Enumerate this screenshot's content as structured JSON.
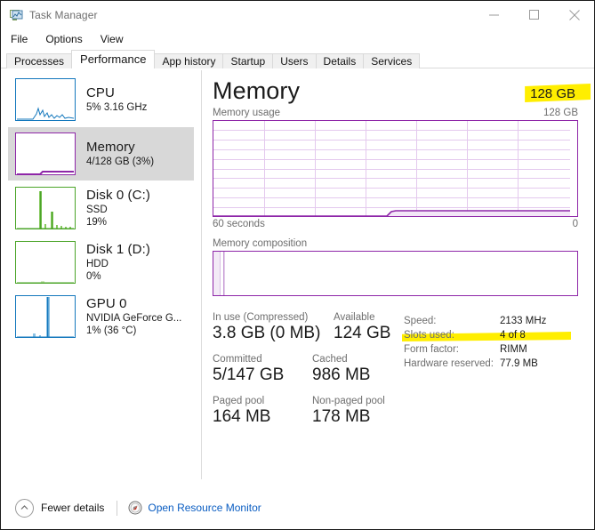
{
  "window": {
    "title": "Task Manager",
    "icon": "task-manager-icon",
    "minimize_label": "Minimize",
    "maximize_label": "Maximize",
    "close_label": "Close"
  },
  "menu": {
    "items": [
      {
        "label": "File"
      },
      {
        "label": "Options"
      },
      {
        "label": "View"
      }
    ]
  },
  "tabs": [
    {
      "label": "Processes",
      "active": false
    },
    {
      "label": "Performance",
      "active": true
    },
    {
      "label": "App history",
      "active": false
    },
    {
      "label": "Startup",
      "active": false
    },
    {
      "label": "Users",
      "active": false
    },
    {
      "label": "Details",
      "active": false
    },
    {
      "label": "Services",
      "active": false
    }
  ],
  "sidebar": {
    "items": [
      {
        "name": "cpu",
        "title": "CPU",
        "sub1": "5%  3.16 GHz",
        "sub2": "",
        "color": "#1478bd",
        "selected": false
      },
      {
        "name": "memory",
        "title": "Memory",
        "sub1": "4/128 GB (3%)",
        "sub2": "",
        "color": "#8e26a8",
        "selected": true
      },
      {
        "name": "disk-0",
        "title": "Disk 0 (C:)",
        "sub1": "SSD",
        "sub2": "19%",
        "color": "#4ba428",
        "selected": false
      },
      {
        "name": "disk-1",
        "title": "Disk 1 (D:)",
        "sub1": "HDD",
        "sub2": "0%",
        "color": "#4ba428",
        "selected": false
      },
      {
        "name": "gpu-0",
        "title": "GPU 0",
        "sub1": "NVIDIA GeForce G...",
        "sub2": "1%  (36 °C)",
        "color": "#1478bd",
        "selected": false
      }
    ]
  },
  "main": {
    "title": "Memory",
    "capacity": "128 GB",
    "capacity_highlight_color": "#ffee00",
    "usage_graph": {
      "label": "Memory usage",
      "max_label": "128 GB",
      "left_axis_label": "60 seconds",
      "right_axis_label": "0",
      "line_color": "#8e26a8",
      "fill_color": "#e6c8ee"
    },
    "composition_graph": {
      "label": "Memory composition",
      "border_color": "#8e26a8"
    },
    "stats": [
      [
        {
          "label": "In use (Compressed)",
          "value": "3.8 GB (0 MB)"
        },
        {
          "label": "Available",
          "value": "124 GB"
        }
      ],
      [
        {
          "label": "Committed",
          "value": "5/147 GB"
        },
        {
          "label": "Cached",
          "value": "986 MB"
        }
      ],
      [
        {
          "label": "Paged pool",
          "value": "164 MB"
        },
        {
          "label": "Non-paged pool",
          "value": "178 MB"
        }
      ]
    ],
    "info": [
      {
        "label": "Speed:",
        "value": "2133 MHz",
        "highlight": false
      },
      {
        "label": "Slots used:",
        "value": "4 of 8",
        "highlight": true
      },
      {
        "label": "Form factor:",
        "value": "RIMM",
        "highlight": false
      },
      {
        "label": "Hardware reserved:",
        "value": "77.9 MB",
        "highlight": false
      }
    ]
  },
  "status": {
    "fewer_details": "Fewer details",
    "open_resource_monitor": "Open Resource Monitor",
    "link_color": "#0a5dc2"
  }
}
